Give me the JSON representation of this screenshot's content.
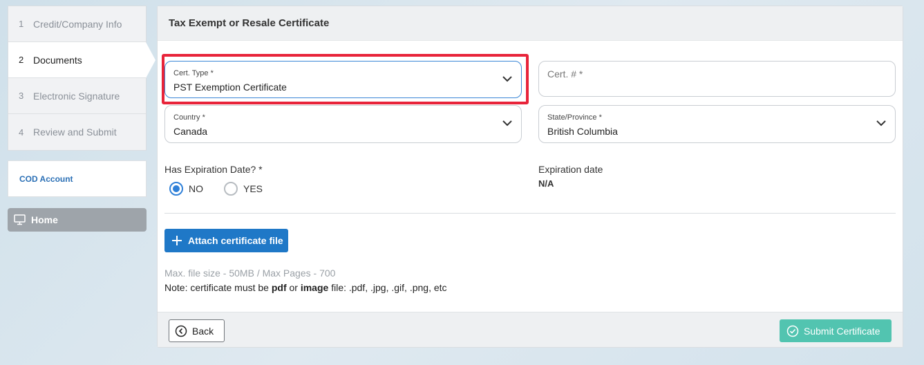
{
  "sidebar": {
    "steps": [
      {
        "num": "1",
        "label": "Credit/Company Info"
      },
      {
        "num": "2",
        "label": "Documents"
      },
      {
        "num": "3",
        "label": "Electronic Signature"
      },
      {
        "num": "4",
        "label": "Review and Submit"
      }
    ],
    "active_step": 2,
    "account_label": "COD Account",
    "home_label": "Home"
  },
  "panel": {
    "title": "Tax Exempt or Resale Certificate",
    "cert_type": {
      "label": "Cert. Type *",
      "value": "PST Exemption Certificate"
    },
    "cert_number": {
      "label": "Cert. # *",
      "value": ""
    },
    "country": {
      "label": "Country *",
      "value": "Canada"
    },
    "state": {
      "label": "State/Province *",
      "value": "British Columbia"
    },
    "has_expiration": {
      "label": "Has Expiration Date? *",
      "options": [
        "NO",
        "YES"
      ],
      "selected": "NO"
    },
    "expiration": {
      "label": "Expiration date",
      "value": "N/A"
    },
    "attach_label": "Attach certificate file",
    "max_size_text": "Max. file size - 50MB / Max Pages - 700",
    "note": {
      "prefix": "Note: certificate must be ",
      "pdf": "pdf",
      "or": " or ",
      "image": "image",
      "suffix": " file: .pdf, .jpg, .gif, .png, etc"
    },
    "back_label": "Back",
    "submit_label": "Submit Certificate"
  },
  "colors": {
    "primary": "#1f78c7",
    "submit": "#52c4b0",
    "highlight": "#e8243a",
    "link": "#2a6fb5"
  }
}
